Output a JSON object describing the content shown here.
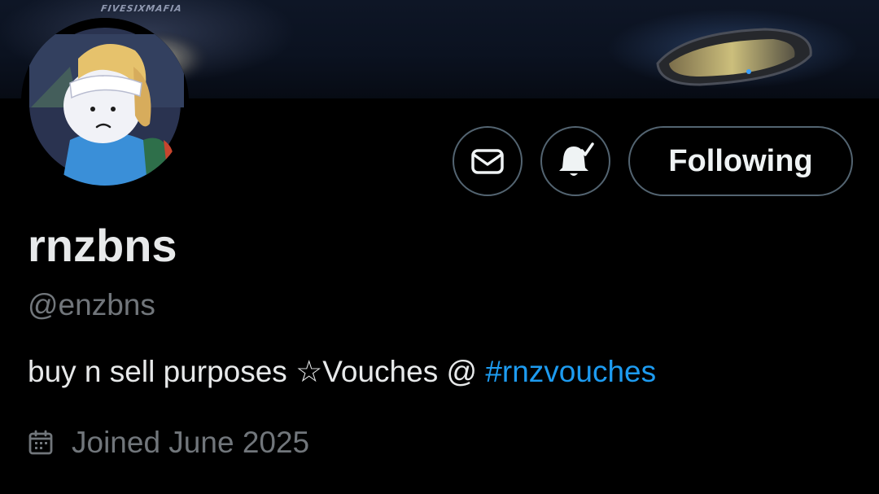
{
  "banner": {
    "wordmark": "FIVESIXMAFIA"
  },
  "profile": {
    "display_name": "rnzbns",
    "handle": "@enzbns",
    "bio_text": "buy n sell purposes  ☆Vouches @ ",
    "bio_hashtag": "#rnzvouches",
    "joined": "Joined June 2025"
  },
  "actions": {
    "message_icon": "envelope-icon",
    "notify_icon": "bell-check-icon",
    "follow_label": "Following"
  },
  "icons": {
    "calendar": "calendar-icon"
  },
  "colors": {
    "background": "#000000",
    "primary_text": "#e7e9ea",
    "secondary_text": "#71767b",
    "link": "#1d9bf0",
    "button_border": "#536471"
  }
}
